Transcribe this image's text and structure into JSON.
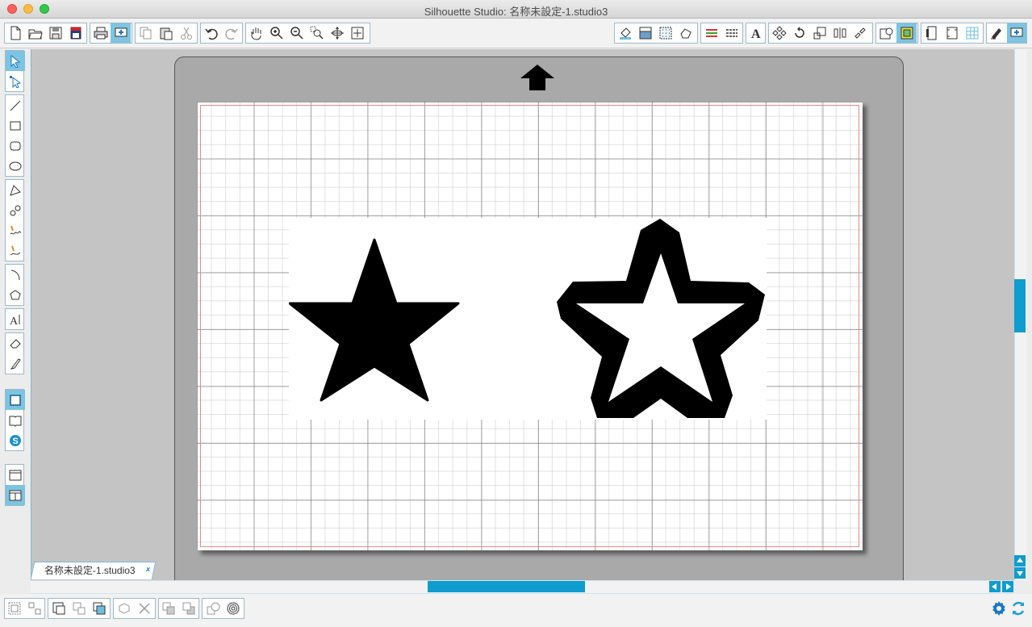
{
  "window": {
    "title": "Silhouette Studio: 名称未設定-1.studio3"
  },
  "document_tab": {
    "label": "名称未設定-1.studio3",
    "close_label": "x"
  },
  "colors": {
    "accent": "#0f9ccf",
    "active_button": "#7cc4e2",
    "cut_border": "#e58a8a",
    "mat": "#a9a9a9"
  },
  "toolbar_left": [
    {
      "group": "file",
      "icons": [
        "new-document-icon",
        "open-folder-icon",
        "save-icon",
        "save-library-icon"
      ]
    },
    {
      "group": "print",
      "icons": [
        "print-icon",
        "send-to-silhouette-icon"
      ]
    },
    {
      "group": "clipboard",
      "icons": [
        "copy-icon",
        "paste-icon",
        "cut-icon"
      ]
    },
    {
      "group": "history",
      "icons": [
        "undo-icon",
        "redo-icon"
      ]
    },
    {
      "group": "view",
      "icons": [
        "pan-hand-icon",
        "zoom-in-icon",
        "zoom-out-icon",
        "zoom-select-icon",
        "drag-zoom-icon",
        "fit-to-page-icon"
      ]
    }
  ],
  "toolbar_right": [
    {
      "group": "fill",
      "icons": [
        "fill-color-icon",
        "gradient-fill-icon",
        "pattern-fill-icon",
        "sketch-icon"
      ]
    },
    {
      "group": "line",
      "icons": [
        "line-color-icon",
        "line-style-icon"
      ]
    },
    {
      "group": "text",
      "icons": [
        "text-style-icon"
      ]
    },
    {
      "group": "transform",
      "icons": [
        "modify-icon",
        "rotate-icon",
        "scale-icon",
        "align-icon",
        "replicate-icon"
      ]
    },
    {
      "group": "panels",
      "icons": [
        "trace-icon",
        "offset-icon"
      ]
    },
    {
      "group": "page",
      "icons": [
        "page-setup-icon",
        "registration-marks-icon",
        "grid-icon"
      ]
    },
    {
      "group": "send",
      "icons": [
        "cut-settings-icon",
        "send-icon"
      ]
    }
  ],
  "left_tools": [
    {
      "group": "select",
      "icons": [
        "select-arrow-icon",
        "point-edit-icon"
      ]
    },
    {
      "group": "shapes",
      "icons": [
        "line-tool-icon",
        "rectangle-tool-icon",
        "rounded-rectangle-tool-icon",
        "ellipse-tool-icon"
      ]
    },
    {
      "group": "draw",
      "icons": [
        "polygon-tool-icon",
        "curve-tool-icon",
        "freehand-tool-icon",
        "smooth-freehand-tool-icon"
      ]
    },
    {
      "group": "arc",
      "icons": [
        "arc-tool-icon",
        "regular-polygon-tool-icon"
      ]
    },
    {
      "group": "type",
      "icons": [
        "text-tool-icon"
      ]
    },
    {
      "group": "erase",
      "icons": [
        "eraser-tool-icon",
        "knife-tool-icon"
      ]
    },
    {
      "group": "library",
      "icons": [
        "design-view-icon",
        "library-icon",
        "silhouette-store-icon"
      ]
    },
    {
      "group": "layout",
      "icons": [
        "single-panel-icon",
        "split-panel-icon"
      ]
    }
  ],
  "bottom_tools": [
    {
      "group": "group",
      "icons": [
        "group-icon",
        "ungroup-icon"
      ]
    },
    {
      "group": "compound",
      "icons": [
        "make-compound-path-icon",
        "release-compound-path-icon",
        "duplicate-icon"
      ]
    },
    {
      "group": "delete",
      "icons": [
        "duplicate-3d-icon",
        "delete-icon"
      ]
    },
    {
      "group": "arrange",
      "icons": [
        "bring-to-front-icon",
        "send-to-back-icon"
      ]
    },
    {
      "group": "weld",
      "icons": [
        "weld-icon",
        "offset-rings-icon"
      ]
    }
  ],
  "status_icons": [
    "settings-gear-icon",
    "sync-icon"
  ]
}
